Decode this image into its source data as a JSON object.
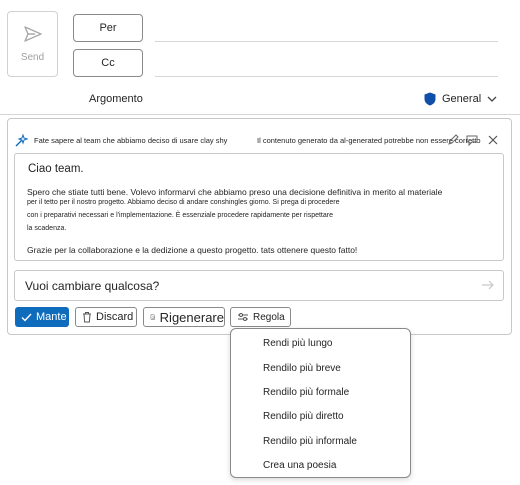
{
  "header": {
    "send_label": "Send",
    "to_label": "Per",
    "cc_label": "Cc",
    "subject_label": "Argomento",
    "sensitivity_label": "General"
  },
  "copilot": {
    "prompt_text": "Fate sapere al team che abbiamo deciso di usare clay shy",
    "disclaimer": "Il contenuto generato da al-generated potrebbe non essere corretto",
    "draft": {
      "greeting": "Ciao team.",
      "line1": "Spero che stiate tutti bene. Volevo informarvi che abbiamo preso una decisione definitiva in merito al materiale",
      "line2": "per il tetto per il nostro progetto. Abbiamo deciso di andare conshingles giorno. Si prega di procedere",
      "line3": "con i preparativi necessari e l'implementazione. È essenziale procedere rapidamente per rispettare",
      "line4": "la scadenza.",
      "line5": "Grazie per la collaborazione e la dedizione a questo progetto. tats ottenere questo fatto!"
    },
    "ask_placeholder": "Vuoi cambiare qualcosa?",
    "keep_label": "Mante",
    "discard_label": "Discard",
    "regenerate_label": "Rigenerare",
    "adjust_label": "Regola"
  },
  "adjust_menu": {
    "items": [
      "Rendi più lungo",
      "Rendilo più breve",
      "Rendilo più formale",
      "Rendilo più diretto",
      "Rendilo più informale",
      "Crea una poesia"
    ]
  },
  "colors": {
    "accent": "#0f6cbd",
    "shield": "#0f4fa8"
  }
}
